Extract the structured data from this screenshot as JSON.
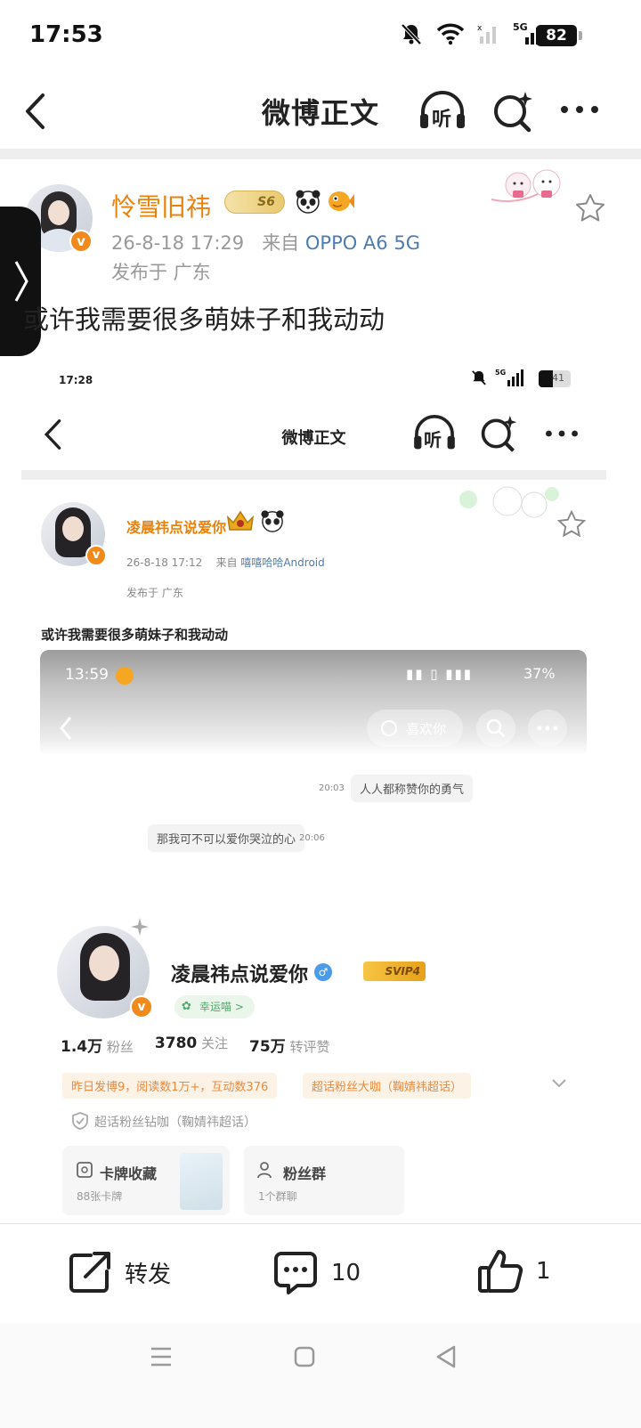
{
  "status_bar": {
    "time": "17:53",
    "battery": "82"
  },
  "nav": {
    "title": "微博正文",
    "listen_label": "听"
  },
  "post": {
    "username": "怜雪旧祎",
    "level_badge": "S6",
    "date": "26-8-18 17:29",
    "from_prefix": "来自",
    "source": "OPPO A6 5G",
    "location": "发布于 广东",
    "text": "或许我需要很多萌妹子和我动动"
  },
  "inner": {
    "status_time": "17:28",
    "battery": "41",
    "nav_title": "微博正文",
    "listen_label": "听",
    "username": "凌晨祎点说爱你",
    "date": "26-8-18 17:12",
    "from_prefix": "来自",
    "source": "嘻嘻哈哈Android",
    "location": "发布于 广东",
    "text": "或许我需要很多萌妹子和我动动",
    "nested": {
      "status_time": "13:59",
      "battery_pct": "37%",
      "like_label": "喜欢你",
      "msg_right_time": "20:03",
      "msg_right": "人人都称赞你的勇气",
      "msg_left": "那我可不可以爱你哭泣的心",
      "msg_left_time": "20:06",
      "profile_name": "凌晨祎点说爱你",
      "vip": "SVIP4",
      "lucky": "幸运喵 >",
      "fans_num": "1.4万",
      "fans_label": "粉丝",
      "follow_num": "3780",
      "follow_label": "关注",
      "repost_num": "75万",
      "repost_label": "转评赞",
      "tag1": "昨日发博9，阅读数1万+，互动数376",
      "tag2": "超话粉丝大咖（鞠婧祎超话）",
      "super_fan": "超话粉丝钻咖（鞠婧祎超话）",
      "card1_title": "卡牌收藏",
      "card1_sub": "88张卡牌",
      "card2_title": "粉丝群",
      "card2_sub": "1个群聊"
    }
  },
  "actions": {
    "repost": "转发",
    "comments": "10",
    "likes": "1"
  },
  "colors": {
    "accent_orange": "#e8820d",
    "link_blue": "#4f7cae"
  }
}
